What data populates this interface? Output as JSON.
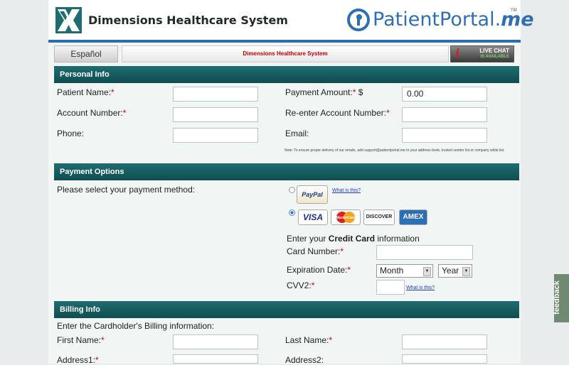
{
  "header": {
    "brand_name": "Dimensions Healthcare System",
    "portal_name": "PatientPortal.",
    "portal_suffix": "me",
    "tm": "TM"
  },
  "topbar": {
    "language": "Español",
    "org_name": "Dimensions Healthcare System",
    "chat_line1": "Live Chat",
    "chat_line2": "is available"
  },
  "personal": {
    "title": "Personal Info",
    "patient_name": "Patient Name:",
    "account_number": "Account Number:",
    "phone": "Phone:",
    "payment_amount": "Payment Amount:",
    "currency": "$",
    "amount_value": "0.00",
    "reenter_account": "Re-enter Account Number:",
    "email": "Email:",
    "note": "Note: To ensure proper delivery of our emails, add support@patientportal.me to your address book, trusted sender list or company white list."
  },
  "payment": {
    "title": "Payment Options",
    "prompt": "Please select your payment method:",
    "paypal": "PayPal",
    "what_is_this": "What is this?",
    "visa": "VISA",
    "mastercard": "MasterCard",
    "discover": "DISCOVER",
    "amex": "AMEX",
    "enter_prefix": "Enter your",
    "enter_bold": "Credit Card",
    "enter_suffix": "information",
    "card_number": "Card Number:",
    "expiration": "Expiration Date:",
    "month": "Month",
    "year": "Year",
    "cvv": "CVV2:",
    "cvv_link": "What is this?"
  },
  "billing": {
    "title": "Billing Info",
    "prompt": "Enter the Cardholder's Billing information:",
    "first_name": "First Name:",
    "last_name": "Last Name:",
    "address1": "Address1:",
    "address2": "Address2:"
  },
  "feedback": "feedback",
  "required_mark": "*"
}
